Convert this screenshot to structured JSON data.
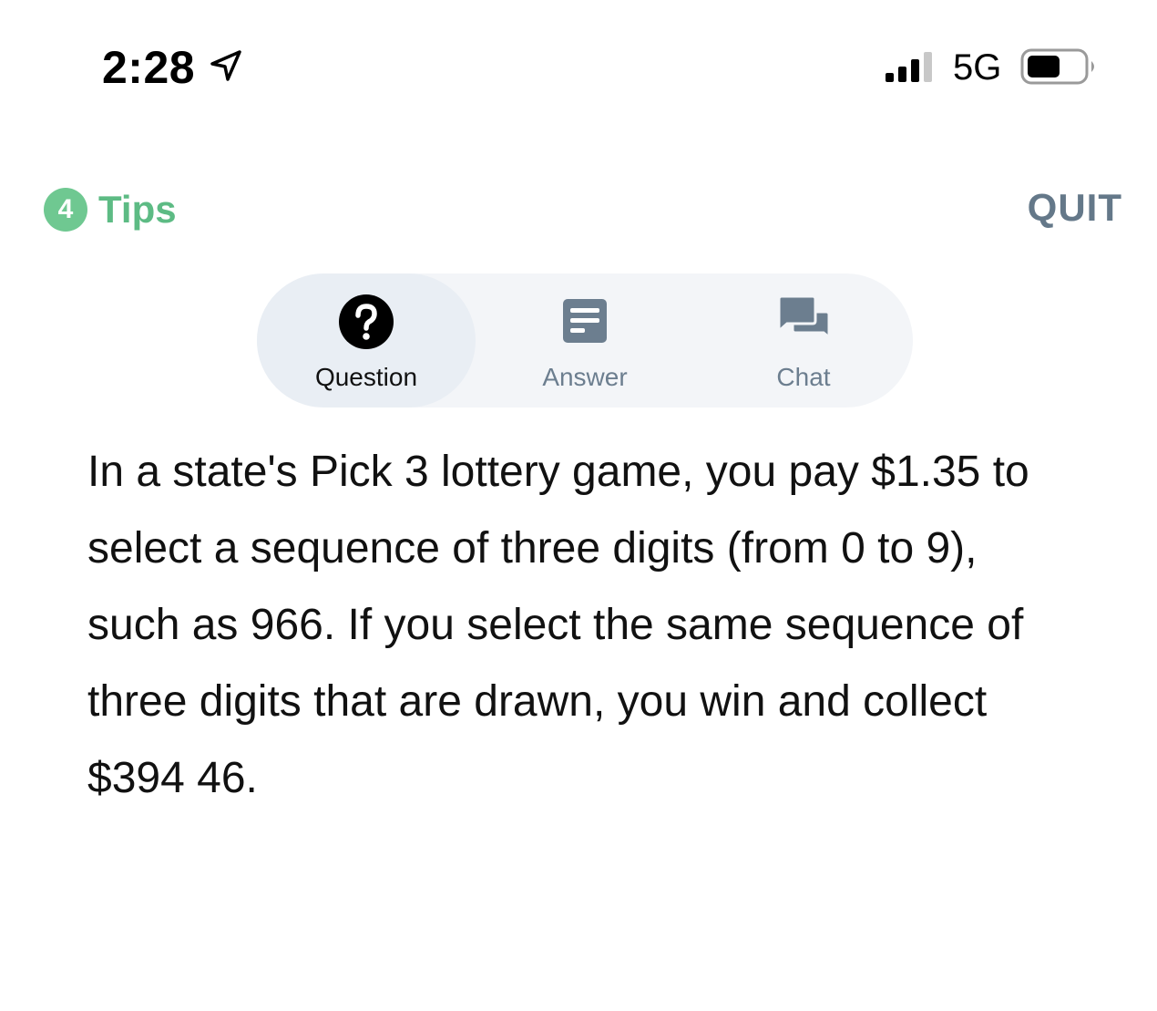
{
  "status_bar": {
    "time": "2:28",
    "network": "5G",
    "icons": [
      "location-arrow-icon",
      "signal-icon",
      "battery-icon"
    ]
  },
  "header": {
    "tips_count": "4",
    "tips_label": "Tips",
    "quit_label": "QUIT"
  },
  "tabs": [
    {
      "label": "Question",
      "icon": "question-icon",
      "active": true
    },
    {
      "label": "Answer",
      "icon": "answer-icon",
      "active": false
    },
    {
      "label": "Chat",
      "icon": "chat-icon",
      "active": false
    }
  ],
  "question": {
    "text": "In a state's Pick 3 lottery game, you pay $1.35 to select a sequence of three digits (from 0 to 9), such as 966. If you select the same sequence of three digits that are drawn, you win and collect $394 46."
  },
  "colors": {
    "tips_green": "#5dbb84",
    "quit_gray": "#647889",
    "tab_inactive": "#6c7e8f"
  }
}
